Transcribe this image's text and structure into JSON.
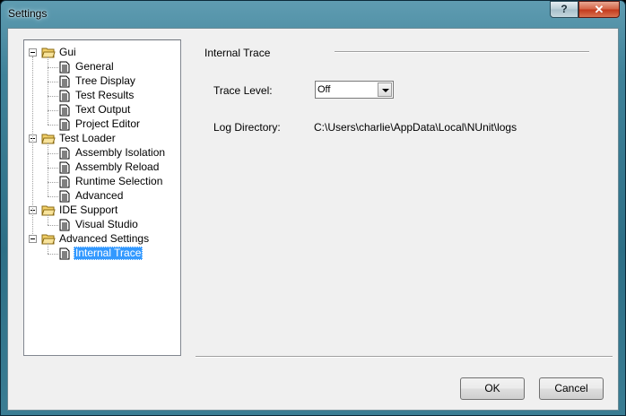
{
  "window": {
    "title": "Settings",
    "help_glyph": "?",
    "close_glyph": "✕"
  },
  "tree": {
    "groups": [
      {
        "label": "Gui",
        "icon": "folder-open-icon",
        "children": [
          "General",
          "Tree Display",
          "Test Results",
          "Text Output",
          "Project Editor"
        ]
      },
      {
        "label": "Test Loader",
        "icon": "folder-open-icon",
        "children": [
          "Assembly Isolation",
          "Assembly Reload",
          "Runtime Selection",
          "Advanced"
        ]
      },
      {
        "label": "IDE Support",
        "icon": "folder-open-icon",
        "children": [
          "Visual Studio"
        ]
      },
      {
        "label": "Advanced Settings",
        "icon": "folder-open-icon",
        "children": [
          "Internal Trace"
        ]
      }
    ],
    "selected": "Internal Trace",
    "leaf_icon": "document-icon"
  },
  "panel": {
    "title": "Internal Trace",
    "trace_level": {
      "label": "Trace Level:",
      "value": "Off"
    },
    "log_directory": {
      "label": "Log Directory:",
      "value": "C:\\Users\\charlie\\AppData\\Local\\NUnit\\logs"
    }
  },
  "buttons": {
    "ok": "OK",
    "cancel": "Cancel"
  },
  "colors": {
    "selection": "#3399ff",
    "dialog_bg": "#f0f0f0"
  }
}
